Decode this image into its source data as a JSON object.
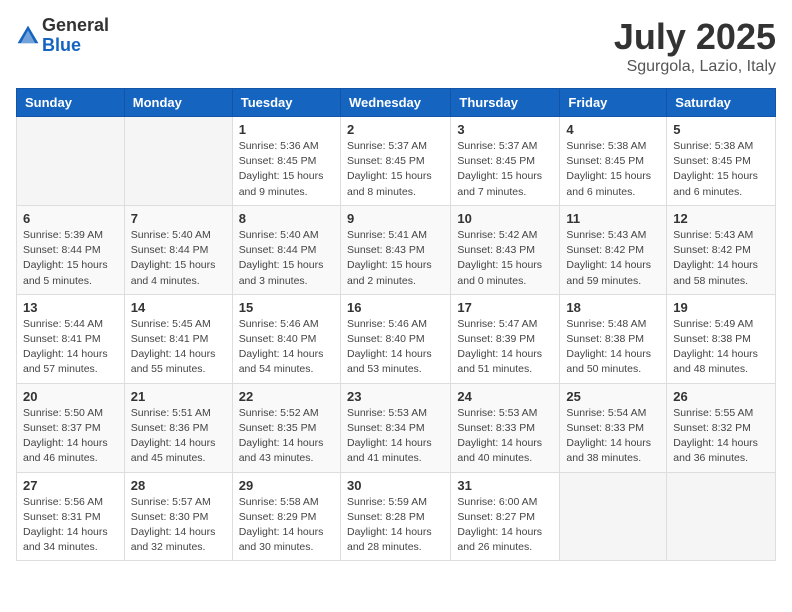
{
  "logo": {
    "general": "General",
    "blue": "Blue"
  },
  "header": {
    "month": "July 2025",
    "location": "Sgurgola, Lazio, Italy"
  },
  "weekdays": [
    "Sunday",
    "Monday",
    "Tuesday",
    "Wednesday",
    "Thursday",
    "Friday",
    "Saturday"
  ],
  "weeks": [
    [
      {
        "day": "",
        "info": ""
      },
      {
        "day": "",
        "info": ""
      },
      {
        "day": "1",
        "info": "Sunrise: 5:36 AM\nSunset: 8:45 PM\nDaylight: 15 hours\nand 9 minutes."
      },
      {
        "day": "2",
        "info": "Sunrise: 5:37 AM\nSunset: 8:45 PM\nDaylight: 15 hours\nand 8 minutes."
      },
      {
        "day": "3",
        "info": "Sunrise: 5:37 AM\nSunset: 8:45 PM\nDaylight: 15 hours\nand 7 minutes."
      },
      {
        "day": "4",
        "info": "Sunrise: 5:38 AM\nSunset: 8:45 PM\nDaylight: 15 hours\nand 6 minutes."
      },
      {
        "day": "5",
        "info": "Sunrise: 5:38 AM\nSunset: 8:45 PM\nDaylight: 15 hours\nand 6 minutes."
      }
    ],
    [
      {
        "day": "6",
        "info": "Sunrise: 5:39 AM\nSunset: 8:44 PM\nDaylight: 15 hours\nand 5 minutes."
      },
      {
        "day": "7",
        "info": "Sunrise: 5:40 AM\nSunset: 8:44 PM\nDaylight: 15 hours\nand 4 minutes."
      },
      {
        "day": "8",
        "info": "Sunrise: 5:40 AM\nSunset: 8:44 PM\nDaylight: 15 hours\nand 3 minutes."
      },
      {
        "day": "9",
        "info": "Sunrise: 5:41 AM\nSunset: 8:43 PM\nDaylight: 15 hours\nand 2 minutes."
      },
      {
        "day": "10",
        "info": "Sunrise: 5:42 AM\nSunset: 8:43 PM\nDaylight: 15 hours\nand 0 minutes."
      },
      {
        "day": "11",
        "info": "Sunrise: 5:43 AM\nSunset: 8:42 PM\nDaylight: 14 hours\nand 59 minutes."
      },
      {
        "day": "12",
        "info": "Sunrise: 5:43 AM\nSunset: 8:42 PM\nDaylight: 14 hours\nand 58 minutes."
      }
    ],
    [
      {
        "day": "13",
        "info": "Sunrise: 5:44 AM\nSunset: 8:41 PM\nDaylight: 14 hours\nand 57 minutes."
      },
      {
        "day": "14",
        "info": "Sunrise: 5:45 AM\nSunset: 8:41 PM\nDaylight: 14 hours\nand 55 minutes."
      },
      {
        "day": "15",
        "info": "Sunrise: 5:46 AM\nSunset: 8:40 PM\nDaylight: 14 hours\nand 54 minutes."
      },
      {
        "day": "16",
        "info": "Sunrise: 5:46 AM\nSunset: 8:40 PM\nDaylight: 14 hours\nand 53 minutes."
      },
      {
        "day": "17",
        "info": "Sunrise: 5:47 AM\nSunset: 8:39 PM\nDaylight: 14 hours\nand 51 minutes."
      },
      {
        "day": "18",
        "info": "Sunrise: 5:48 AM\nSunset: 8:38 PM\nDaylight: 14 hours\nand 50 minutes."
      },
      {
        "day": "19",
        "info": "Sunrise: 5:49 AM\nSunset: 8:38 PM\nDaylight: 14 hours\nand 48 minutes."
      }
    ],
    [
      {
        "day": "20",
        "info": "Sunrise: 5:50 AM\nSunset: 8:37 PM\nDaylight: 14 hours\nand 46 minutes."
      },
      {
        "day": "21",
        "info": "Sunrise: 5:51 AM\nSunset: 8:36 PM\nDaylight: 14 hours\nand 45 minutes."
      },
      {
        "day": "22",
        "info": "Sunrise: 5:52 AM\nSunset: 8:35 PM\nDaylight: 14 hours\nand 43 minutes."
      },
      {
        "day": "23",
        "info": "Sunrise: 5:53 AM\nSunset: 8:34 PM\nDaylight: 14 hours\nand 41 minutes."
      },
      {
        "day": "24",
        "info": "Sunrise: 5:53 AM\nSunset: 8:33 PM\nDaylight: 14 hours\nand 40 minutes."
      },
      {
        "day": "25",
        "info": "Sunrise: 5:54 AM\nSunset: 8:33 PM\nDaylight: 14 hours\nand 38 minutes."
      },
      {
        "day": "26",
        "info": "Sunrise: 5:55 AM\nSunset: 8:32 PM\nDaylight: 14 hours\nand 36 minutes."
      }
    ],
    [
      {
        "day": "27",
        "info": "Sunrise: 5:56 AM\nSunset: 8:31 PM\nDaylight: 14 hours\nand 34 minutes."
      },
      {
        "day": "28",
        "info": "Sunrise: 5:57 AM\nSunset: 8:30 PM\nDaylight: 14 hours\nand 32 minutes."
      },
      {
        "day": "29",
        "info": "Sunrise: 5:58 AM\nSunset: 8:29 PM\nDaylight: 14 hours\nand 30 minutes."
      },
      {
        "day": "30",
        "info": "Sunrise: 5:59 AM\nSunset: 8:28 PM\nDaylight: 14 hours\nand 28 minutes."
      },
      {
        "day": "31",
        "info": "Sunrise: 6:00 AM\nSunset: 8:27 PM\nDaylight: 14 hours\nand 26 minutes."
      },
      {
        "day": "",
        "info": ""
      },
      {
        "day": "",
        "info": ""
      }
    ]
  ]
}
